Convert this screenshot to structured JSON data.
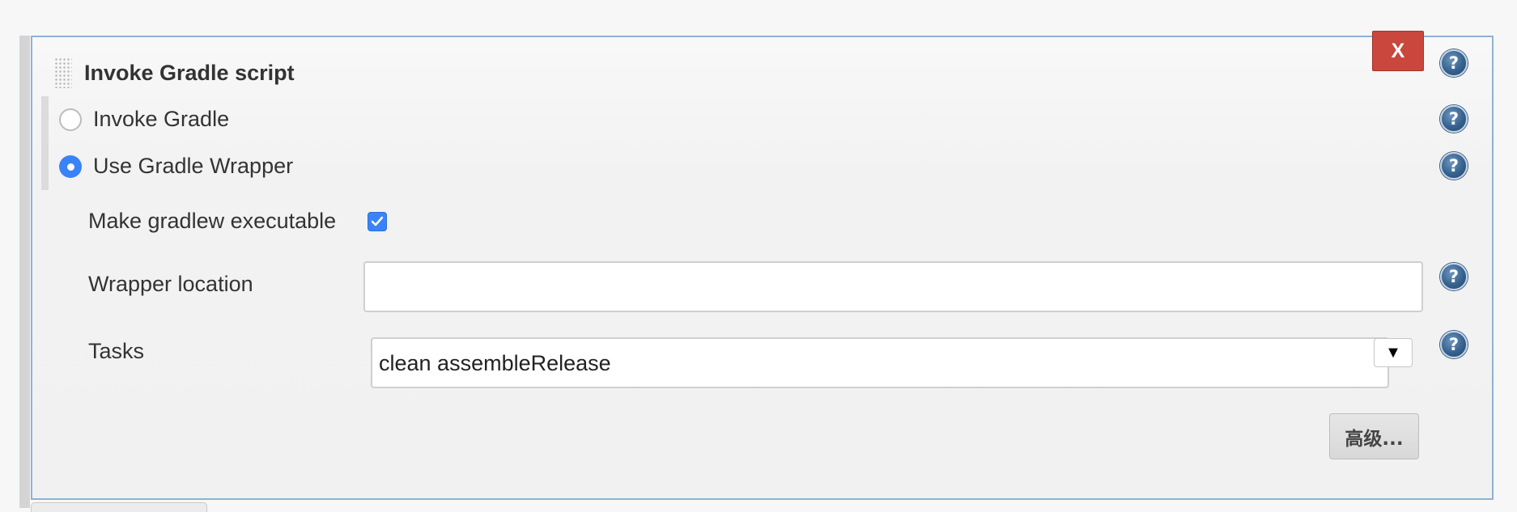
{
  "step": {
    "title": "Invoke Gradle script",
    "close_label": "X",
    "help_label": "?"
  },
  "mode": {
    "options": [
      {
        "label": "Invoke Gradle",
        "selected": false
      },
      {
        "label": "Use Gradle Wrapper",
        "selected": true
      }
    ]
  },
  "fields": {
    "make_executable": {
      "label": "Make gradlew executable",
      "checked": true
    },
    "wrapper_location": {
      "label": "Wrapper location",
      "value": ""
    },
    "tasks": {
      "label": "Tasks",
      "value": "clean assembleRelease",
      "dropdown_label": "▼"
    }
  },
  "actions": {
    "advanced_label": "高级..."
  },
  "colors": {
    "accent": "#3a82f7",
    "close": "#c9473c",
    "panel_border": "#8eb2d7"
  },
  "icons": [
    "drag-handle-icon",
    "help-icon",
    "checkmark-icon",
    "dropdown-arrow-icon"
  ]
}
